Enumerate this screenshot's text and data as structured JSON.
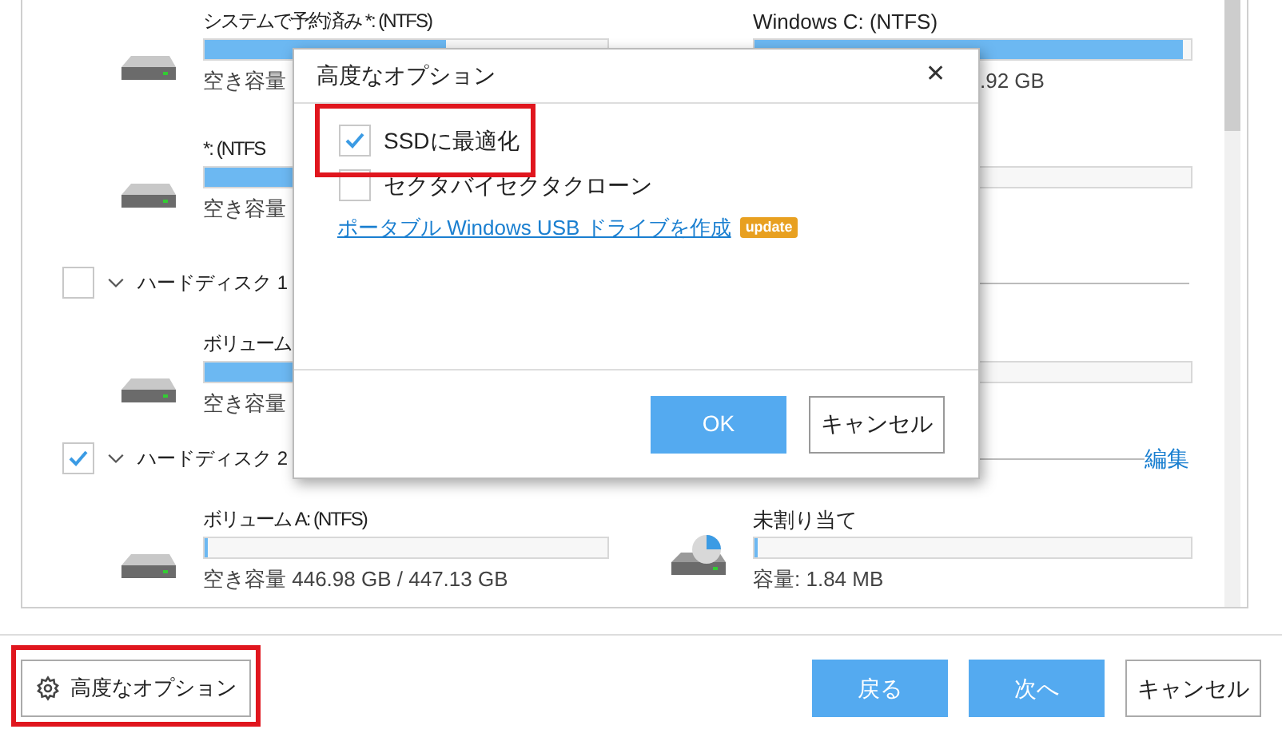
{
  "partition_list": {
    "top_partitions": [
      {
        "kind": "drive",
        "name": "システムで予約済み *: (NTFS)",
        "level": 0.6,
        "caption": "空き容量"
      },
      {
        "kind": "bar",
        "name": "Windows C: (NTFS)",
        "level": 0.98,
        "caption": ".92 GB"
      },
      {
        "kind": "drive",
        "name": "*: (NTFS",
        "level": 0.6,
        "caption": "空き容量"
      },
      {
        "kind": "bar",
        "level": 0
      }
    ],
    "disks": [
      {
        "label": "ハードディスク 1",
        "checked": false,
        "partitions": [
          {
            "kind": "drive",
            "name": "ボリューム",
            "level": 0.6,
            "caption": "空き容量"
          },
          {
            "kind": "bar",
            "level": 0
          }
        ]
      },
      {
        "label": "ハードディスク 2",
        "checked": true,
        "edit_link": "編集",
        "partitions": [
          {
            "kind": "drive",
            "name": "ボリューム A: (NTFS)",
            "level": 0.005,
            "caption": "空き容量 446.98 GB / 447.13 GB"
          },
          {
            "kind": "unallocated",
            "name": "未割り当て",
            "level": 0,
            "caption": "容量: 1.84 MB"
          }
        ]
      }
    ]
  },
  "footer": {
    "advanced_button": "高度なオプション",
    "buttons": [
      {
        "label": "戻る",
        "kind": "primary"
      },
      {
        "label": "次へ",
        "kind": "primary"
      },
      {
        "label": "キャンセル",
        "kind": "secondary"
      }
    ]
  },
  "dialog": {
    "title": "高度なオプション",
    "close": "✕",
    "options": [
      {
        "label": "SSDに最適化",
        "checked": true
      },
      {
        "label": "セクタバイセクタクローン",
        "checked": false
      }
    ],
    "link": "ポータブル Windows USB ドライブを作成",
    "badge": "update",
    "ok": "OK",
    "cancel": "キャンセル"
  }
}
